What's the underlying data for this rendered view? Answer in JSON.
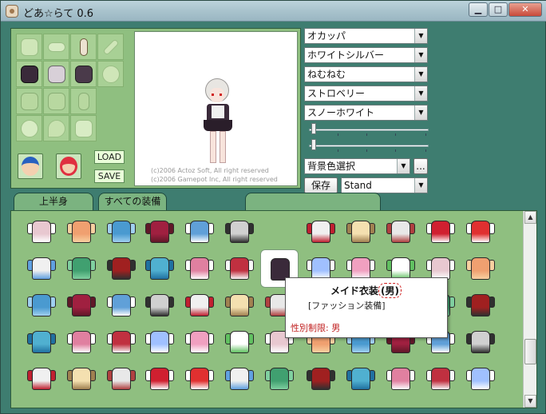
{
  "window": {
    "title": "どあ☆らて 0.6",
    "controls": {
      "minimize": "▁",
      "maximize": "□",
      "close": "✕"
    }
  },
  "preview": {
    "copyright_line1": "(c)2006 Actoz Soft, All right reserved",
    "copyright_line2": "(c)2006 Gamepot Inc, All right reserved"
  },
  "buttons": {
    "load": "LOAD",
    "save": "SAVE",
    "store": "保存",
    "more": "..."
  },
  "selects": {
    "hair_style": "オカッパ",
    "hair_color": "ホワイトシルバー",
    "face": "ねむねむ",
    "eye_color": "ストロベリー",
    "skin_color": "スノーホワイト",
    "bg_color": "背景色選択",
    "motion": "Stand"
  },
  "tabs": [
    {
      "label": "上半身"
    },
    {
      "label": "すべての装備"
    },
    {
      "label": ""
    }
  ],
  "tooltip": {
    "name": "メイド衣装",
    "gender": "(男)",
    "category": "[ファッション装備]",
    "restriction": "性別制限: 男"
  },
  "colors": {
    "window_bg": "#3e7d70",
    "panel_bg": "#8fbf80",
    "restriction_text": "#c02020"
  },
  "icons": {
    "equip_slots": [
      "hat-icon",
      "glasses-icon",
      "earring-icon",
      "weapon-icon",
      "outfit-icon",
      "outfit-icon",
      "outfit-icon",
      "shield-icon",
      "cape-icon",
      "gloves-icon",
      "boots-icon",
      "face-icon",
      "accessory-icon",
      "ring-icon"
    ],
    "face_buttons": [
      "male-face-icon",
      "female-face-icon"
    ]
  }
}
